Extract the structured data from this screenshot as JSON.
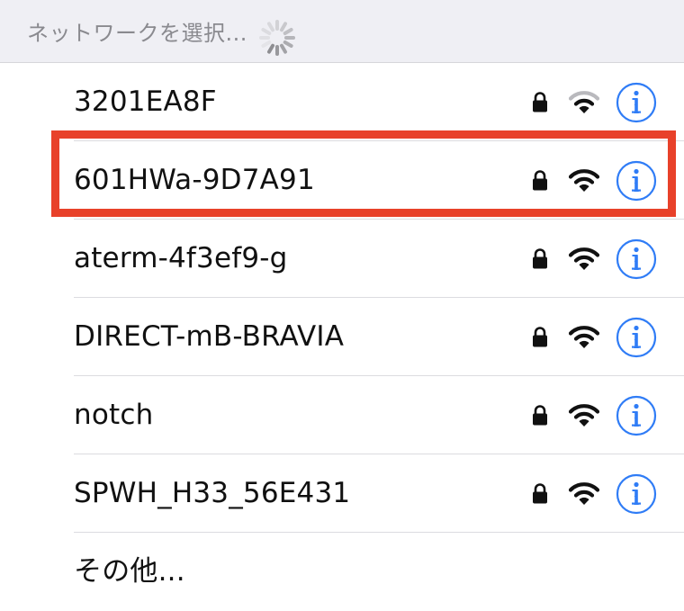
{
  "header": {
    "title": "ネットワークを選択..."
  },
  "networks": [
    {
      "name": "3201EA8F",
      "secured": true,
      "signal": "medium"
    },
    {
      "name": "601HWa-9D7A91",
      "secured": true,
      "signal": "full",
      "highlighted": true
    },
    {
      "name": "aterm-4f3ef9-g",
      "secured": true,
      "signal": "full"
    },
    {
      "name": "DIRECT-mB-BRAVIA",
      "secured": true,
      "signal": "full"
    },
    {
      "name": "notch",
      "secured": true,
      "signal": "full"
    },
    {
      "name": "SPWH_H33_56E431",
      "secured": true,
      "signal": "full"
    }
  ],
  "other": {
    "label": "その他..."
  },
  "colors": {
    "header_bg": "#efeff4",
    "accent_blue": "#2f7cf6",
    "highlight_red": "#e8412a"
  },
  "icons": {
    "lock": "lock-icon",
    "wifi": "wifi-icon",
    "info": "info-icon",
    "spinner": "spinner-icon"
  }
}
